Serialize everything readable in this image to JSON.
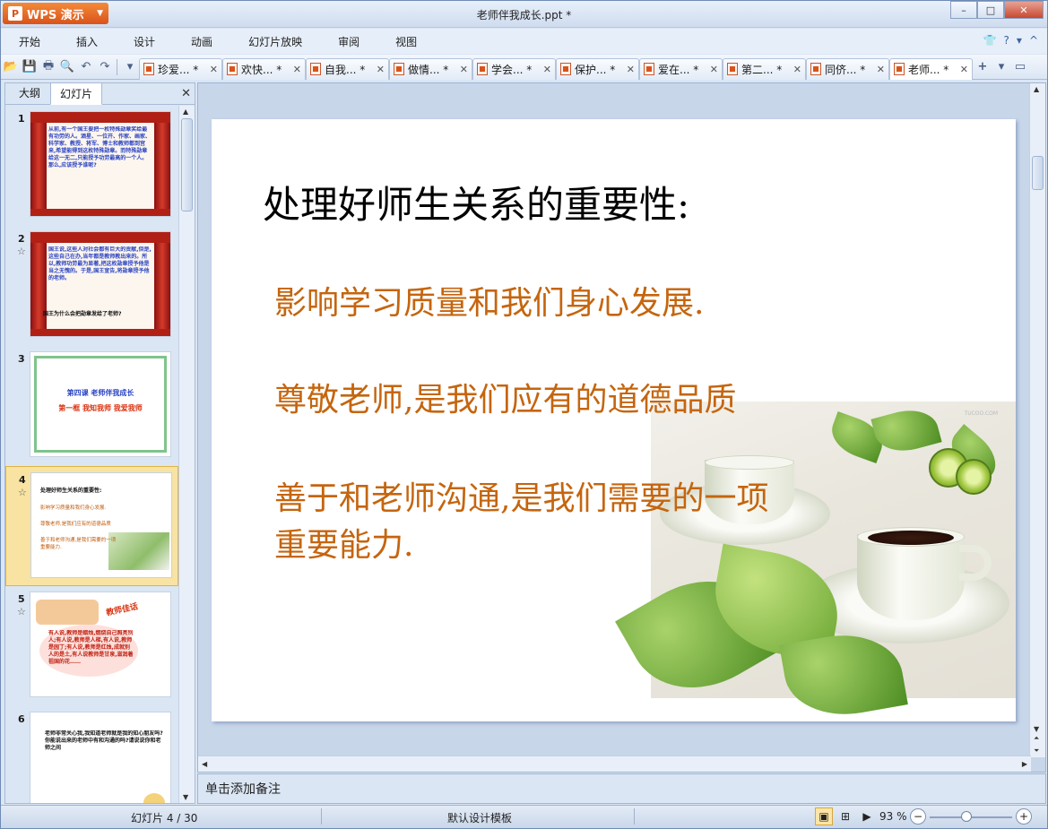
{
  "app": {
    "name": "WPS 演示",
    "window_title": "老师伴我成长.ppt *",
    "controls": {
      "minimize": "–",
      "maximize": "□",
      "close": "✕"
    }
  },
  "menu": [
    "开始",
    "插入",
    "设计",
    "动画",
    "幻灯片放映",
    "审阅",
    "视图"
  ],
  "menu_right_icons": [
    "shirt-icon",
    "help-icon"
  ],
  "toolbar_icons": [
    "open-icon",
    "save-icon",
    "print-icon",
    "print-preview-icon",
    "undo-icon",
    "redo-icon",
    "customize-icon"
  ],
  "doc_tabs": [
    {
      "label": "珍爱... *"
    },
    {
      "label": "欢快... *"
    },
    {
      "label": "自我... *"
    },
    {
      "label": "做情... *"
    },
    {
      "label": "学会... *"
    },
    {
      "label": "保护... *"
    },
    {
      "label": "爱在... *"
    },
    {
      "label": "第二... *"
    },
    {
      "label": "同侪... *"
    },
    {
      "label": "老师... *"
    }
  ],
  "left_pane": {
    "tabs": [
      "大纲",
      "幻灯片"
    ],
    "active_tab": "幻灯片",
    "thumbnails": [
      {
        "num": "1",
        "text": "从前,有一个国王要把一枚特殊勋章奖给最有功劳的人。酒星、一位开、作家、画家、科学家、教授、将军、博士和教师都到宫来,希望能得到这枚特殊勋章。而特殊勋章给这一无二,只能授予功劳最高的一个人。那么,应该授予谁呢?"
      },
      {
        "num": "2",
        "star": "☆",
        "text": "国王说,这些人对社会都有巨大的贡献,但是,这些自己在办,当年都是教师教出来的。所以,教师功劳最为显著,把这枚勋章授予他是当之无愧的。于是,国王宣告,将勋章授予他的老师。",
        "bottom": "国王为什么会把勋章发给了老师?"
      },
      {
        "num": "3",
        "title": "第四课 老师伴我成长",
        "sub": "第一框 我知我师 我爱我师"
      },
      {
        "num": "4",
        "star": "☆",
        "lines": [
          "处理好师生关系的重要性:",
          "影响学习质量和我们身心发展.",
          "尊敬老师,是我们应有的道德品质",
          "善于和老师沟通,是我们需要的一项",
          "重要能力."
        ]
      },
      {
        "num": "5",
        "star": "☆",
        "badge": "教师佳话",
        "text": "有人说,教师是蜡烛,燃烧自己照亮别人;有人说,教师是人梯,有人说,教师是园丁;有人说,教师是红烛,成就别人的是土,有人说教师是甘泉,滋润着祖国的花……"
      },
      {
        "num": "6",
        "text": "老师非常关心我,我知道老师就是我的知心朋友吗?你能说出来的老师中有和沟通的吗?请说说你和老师之间"
      }
    ]
  },
  "slide": {
    "title": "处理好师生关系的重要性:",
    "lines": [
      "影响学习质量和我们身心发展.",
      "尊敬老师,是我们应有的道德品质",
      "善于和老师沟通,是我们需要的一项",
      "重要能力."
    ],
    "watermark": "TUCOO.COM",
    "text_color": "#c5650e"
  },
  "notes_placeholder": "单击添加备注",
  "status": {
    "slide_indicator": "幻灯片 4 / 30",
    "template": "默认设计模板",
    "zoom": "93 %",
    "zoom_level_fraction": 0.45
  }
}
